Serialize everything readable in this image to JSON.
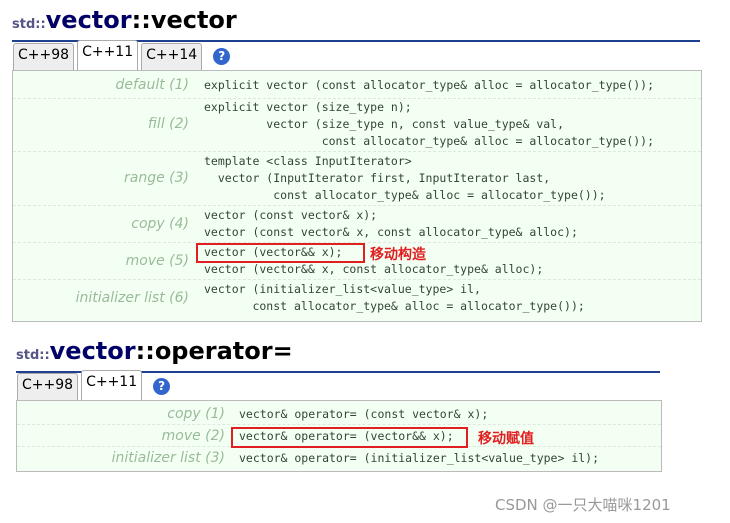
{
  "section1": {
    "ns": "std::",
    "cls": "vector",
    "sep": "::",
    "member": "vector",
    "tabs": [
      "C++98",
      "C++11",
      "C++14"
    ],
    "active_tab": "C++11",
    "help_icon": "?",
    "rows": [
      {
        "label": "default (1)",
        "code": "explicit vector (const allocator_type& alloc = allocator_type());"
      },
      {
        "label": "fill (2)",
        "code": "explicit vector (size_type n);\n         vector (size_type n, const value_type& val,\n                 const allocator_type& alloc = allocator_type());"
      },
      {
        "label": "range (3)",
        "code": "template <class InputIterator>\n  vector (InputIterator first, InputIterator last,\n          const allocator_type& alloc = allocator_type());"
      },
      {
        "label": "copy (4)",
        "code": "vector (const vector& x);\nvector (const vector& x, const allocator_type& alloc);"
      },
      {
        "label": "move (5)",
        "code": "vector (vector&& x);\nvector (vector&& x, const allocator_type& alloc);"
      },
      {
        "label": "initializer list (6)",
        "code": "vector (initializer_list<value_type> il,\n       const allocator_type& alloc = allocator_type());"
      }
    ],
    "annotation": "移动构造"
  },
  "section2": {
    "ns": "std::",
    "cls": "vector",
    "sep": "::",
    "member": "operator=",
    "tabs": [
      "C++98",
      "C++11"
    ],
    "active_tab": "C++11",
    "help_icon": "?",
    "rows": [
      {
        "label": "copy (1)",
        "code": "vector& operator= (const vector& x);"
      },
      {
        "label": "move (2)",
        "code": "vector& operator= (vector&& x);"
      },
      {
        "label": "initializer list (3)",
        "code": "vector& operator= (initializer_list<value_type> il);"
      }
    ],
    "annotation": "移动赋值"
  },
  "watermark": "CSDN @一只大喵咪1201",
  "colors": {
    "highlight": "#e02020",
    "title": "#000066",
    "table_bg": "#f4fff4"
  }
}
